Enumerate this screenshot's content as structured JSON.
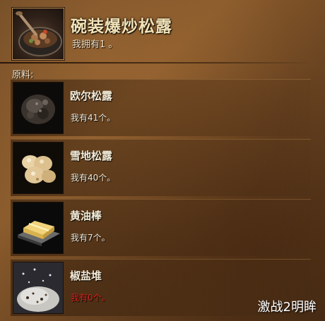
{
  "recipe": {
    "title": "碗装爆炒松露",
    "owned_text": "我拥有1 。",
    "icon": "sauteed-truffle-bowl-icon"
  },
  "ingredients_label": "原料:",
  "ingredients": [
    {
      "name": "欧尔松露",
      "count_text": "我有41个。",
      "icon": "orr-truffle-icon",
      "sufficient": true
    },
    {
      "name": "雪地松露",
      "count_text": "我有40个。",
      "icon": "snow-truffle-icon",
      "sufficient": true
    },
    {
      "name": "黄油棒",
      "count_text": "我有7个。",
      "icon": "stick-of-butter-icon",
      "sufficient": true
    },
    {
      "name": "椒盐堆",
      "count_text": "我有0个。",
      "icon": "pile-of-salt-and-pepper-icon",
      "sufficient": false
    }
  ],
  "watermark": "激战2明眸",
  "colors": {
    "title": "#f2e3b7",
    "insufficient_count": "#d8231a",
    "background": "#7a5028"
  }
}
